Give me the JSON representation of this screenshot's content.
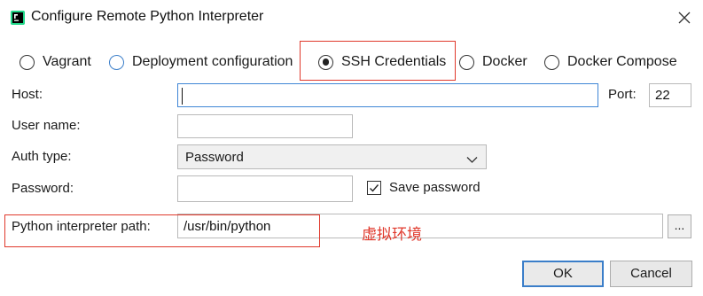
{
  "window": {
    "title": "Configure Remote Python Interpreter"
  },
  "interpreter_types": [
    {
      "label": "Vagrant"
    },
    {
      "label": "Deployment configuration"
    },
    {
      "label": "SSH Credentials"
    },
    {
      "label": "Docker"
    },
    {
      "label": "Docker Compose"
    }
  ],
  "selected_type": "SSH Credentials",
  "form": {
    "host_label": "Host:",
    "host_value": "",
    "port_label": "Port:",
    "port_value": "22",
    "username_label": "User name:",
    "username_value": "",
    "auth_type_label": "Auth type:",
    "auth_type_value": "Password",
    "password_label": "Password:",
    "password_value": "",
    "save_password_label": "Save password",
    "save_password_checked": true,
    "interpreter_path_label": "Python interpreter path:",
    "interpreter_path_value": "/usr/bin/python",
    "browse_label": "..."
  },
  "annotation_text": "虚拟环境",
  "buttons": {
    "ok": "OK",
    "cancel": "Cancel"
  },
  "colors": {
    "annotation_red": "#e0392c",
    "focus_blue": "#3f86d6"
  }
}
